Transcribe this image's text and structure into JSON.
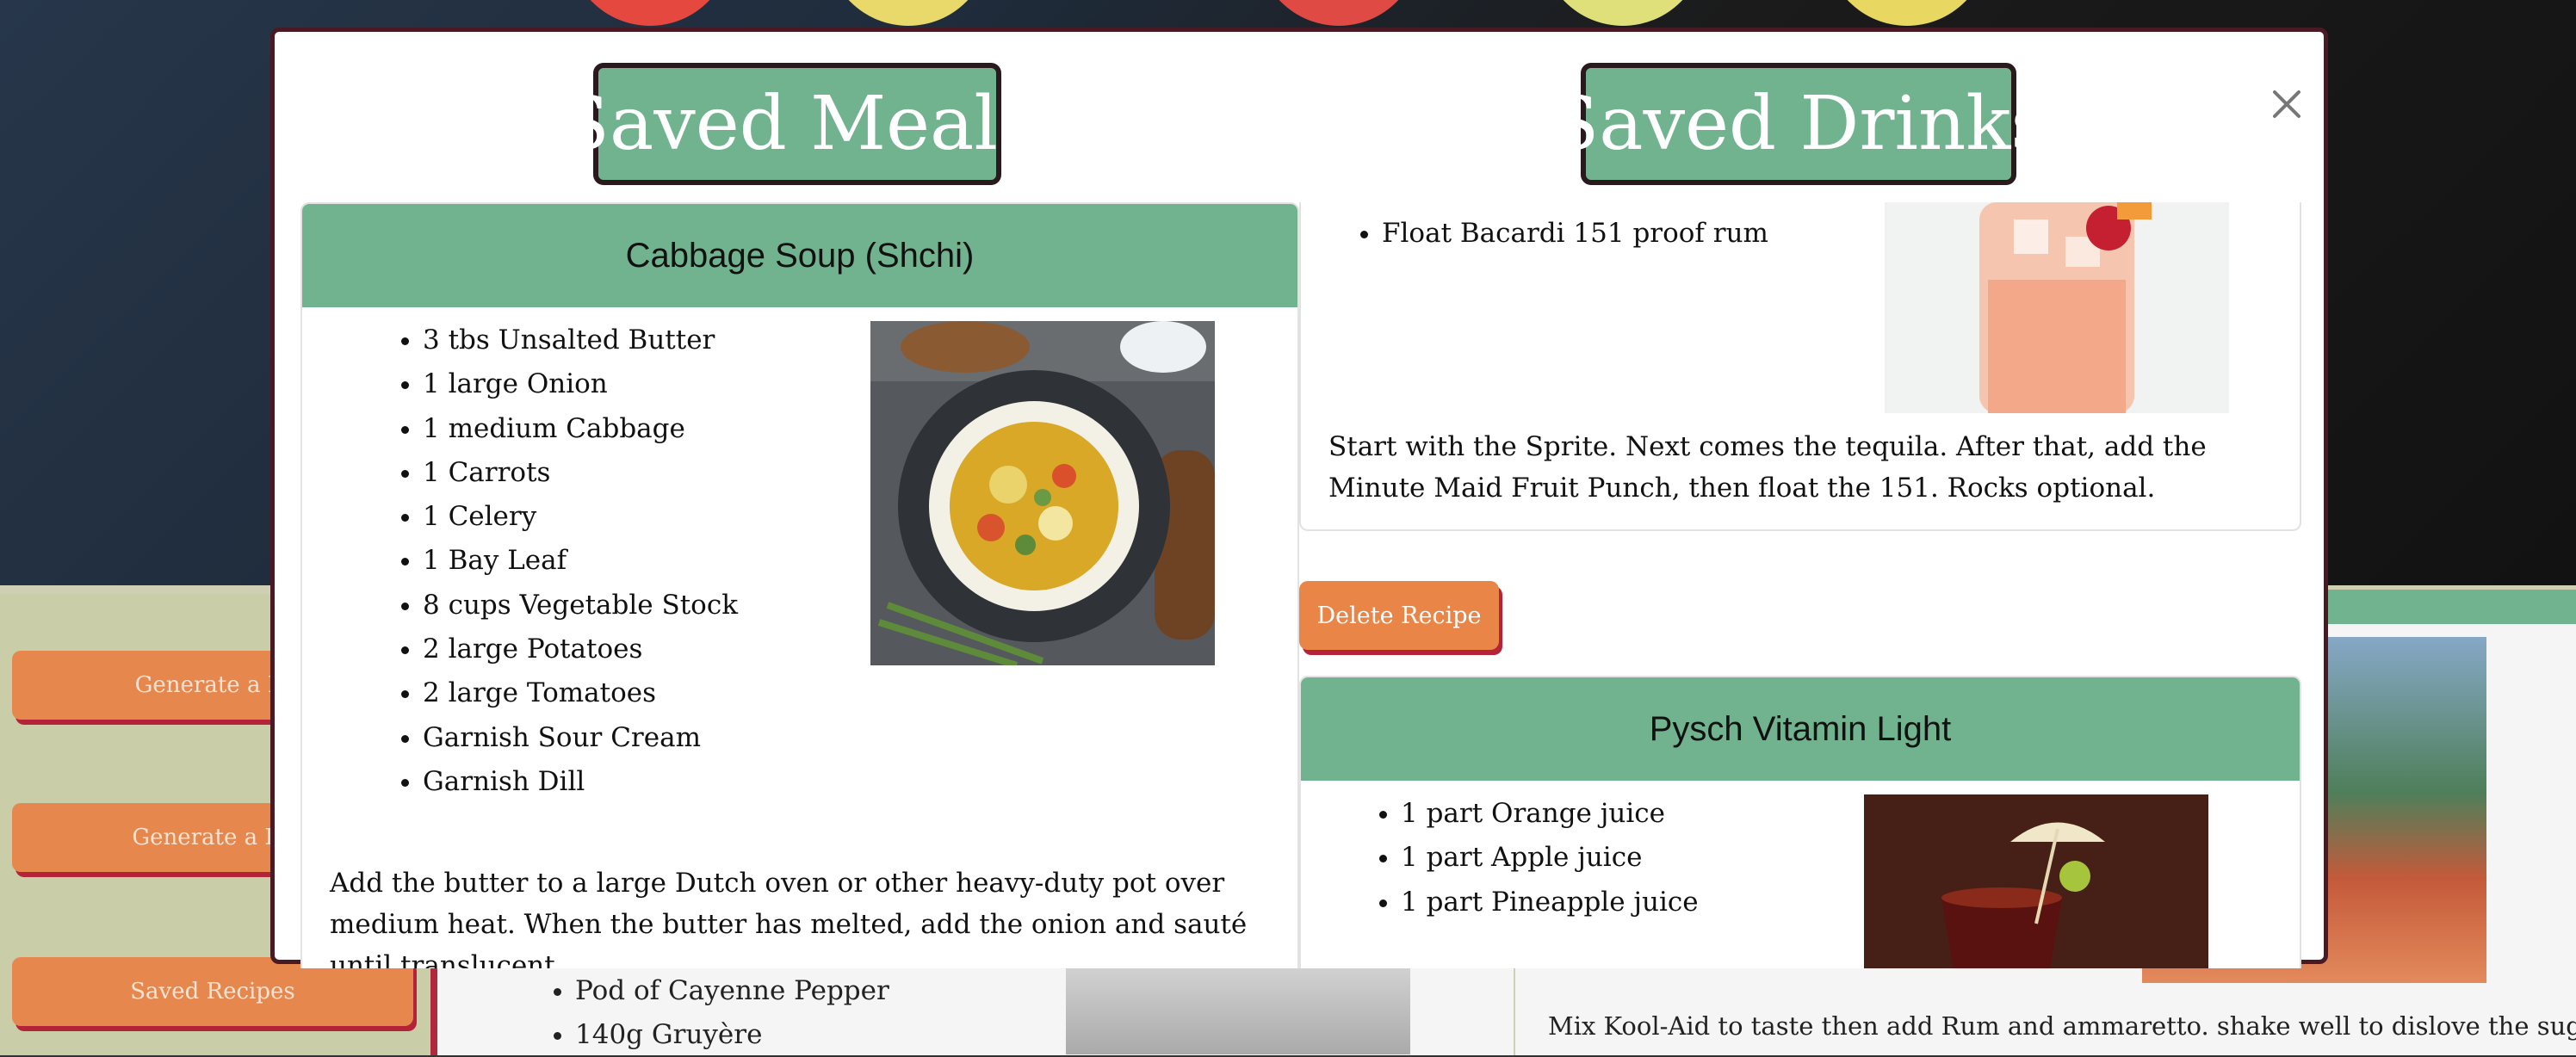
{
  "modal": {
    "meals_heading": "Saved Meals",
    "drinks_heading": "Saved Drinks",
    "close_label": "×"
  },
  "meal_card": {
    "title": "Cabbage Soup (Shchi)",
    "ingredients": [
      "3 tbs Unsalted Butter",
      "1 large Onion",
      "1 medium Cabbage",
      "1 Carrots",
      "1 Celery",
      "1 Bay Leaf",
      "8 cups Vegetable Stock",
      "2 large Potatoes",
      "2 large Tomatoes",
      "Garnish Sour Cream",
      "Garnish Dill"
    ],
    "instructions": "Add the butter to a large Dutch oven or other heavy-duty pot over medium heat. When the butter has melted, add the onion and sauté until translucent."
  },
  "drink_card_1": {
    "ingredients": [
      "Float Bacardi 151 proof rum"
    ],
    "instructions": "Start with the Sprite. Next comes the tequila. After that, add the Minute Maid Fruit Punch, then float the 151. Rocks optional.",
    "delete_label": "Delete Recipe"
  },
  "drink_card_2": {
    "title": "Pysch Vitamin Light",
    "ingredients": [
      "1 part Orange juice",
      "1 part Apple juice",
      "1 part Pineapple juice"
    ]
  },
  "background": {
    "sidebar_buttons": [
      "Generate a M",
      "Generate a Dr",
      "Saved Recipes"
    ],
    "meal_ingredients": [
      "Pod of Cayenne Pepper",
      "140g Gruyère"
    ],
    "drink_instructions": "Mix Kool-Aid to taste then add Rum and ammaretto. shake well to dislove the sugar"
  },
  "colors": {
    "accent_green": "#72b38f",
    "button_orange": "#ea8548",
    "button_shadow": "#b52338",
    "modal_border": "#4a1a24"
  }
}
